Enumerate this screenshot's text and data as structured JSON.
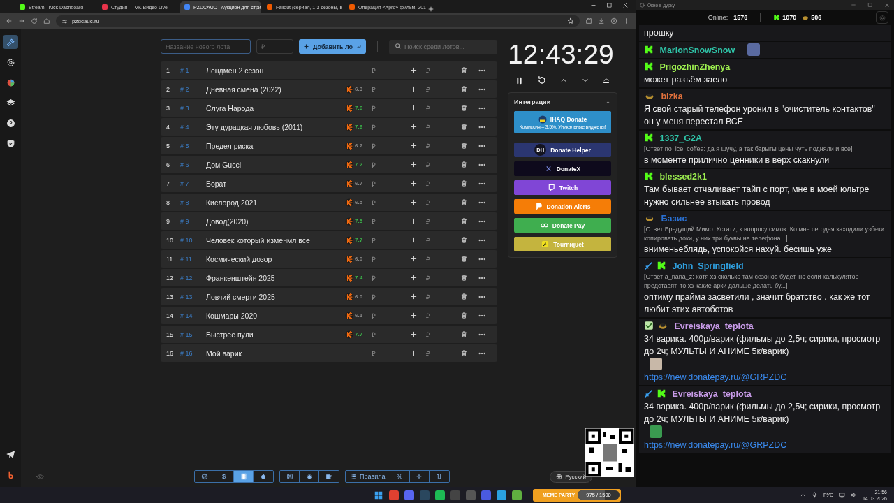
{
  "browser": {
    "tabs": [
      {
        "title": "Stream - Kick Dashboard",
        "selected": false,
        "color": "#53fc18"
      },
      {
        "title": "Студия — VK Видео Live",
        "selected": false,
        "color": "#e8334a"
      },
      {
        "title": "PZDCAUC | Аукцион для стри",
        "selected": true,
        "color": "#4285f4"
      },
      {
        "title": "Fallout (сериал, 1-3 сезоны, в",
        "selected": false,
        "color": "#f05a00"
      },
      {
        "title": "Операция «Арго» фильм, 201",
        "selected": false,
        "color": "#f05a00"
      }
    ],
    "address": "pzdcauc.ru"
  },
  "sidebar": {
    "items": [
      {
        "selected": true
      },
      {
        "selected": false
      },
      {
        "selected": false
      },
      {
        "selected": false
      },
      {
        "selected": false
      },
      {
        "selected": false
      }
    ],
    "footer_items": [
      {
        "selected": false
      },
      {
        "selected": false
      }
    ]
  },
  "lot_form": {
    "name_placeholder": "Название нового лота",
    "price_placeholder": "₽",
    "add_button": "Добавить ло",
    "search_placeholder": "Поиск среди лотов..."
  },
  "lots": [
    {
      "number": "1",
      "id": "# 1",
      "title": "Лендмен 2 сезон",
      "amount": "₽",
      "price_placeholder": "₽"
    },
    {
      "number": "2",
      "id": "# 2",
      "title": "Дневная смена (2022)",
      "rating": {
        "value": "6.3",
        "color": "#8a8a8a"
      },
      "amount": "₽",
      "price_placeholder": "₽"
    },
    {
      "number": "3",
      "id": "# 3",
      "title": "Слуга Народа",
      "rating": {
        "value": "7.6",
        "color": "#3bb54a"
      },
      "amount": "₽",
      "price_placeholder": "₽"
    },
    {
      "number": "4",
      "id": "# 4",
      "title": "Эту дурацкая любовь (2011)",
      "rating": {
        "value": "7.6",
        "color": "#3bb54a"
      },
      "amount": "₽",
      "price_placeholder": "₽"
    },
    {
      "number": "5",
      "id": "# 5",
      "title": "Предел риска",
      "rating": {
        "value": "6.7",
        "color": "#8a8a8a"
      },
      "amount": "₽",
      "price_placeholder": "₽"
    },
    {
      "number": "6",
      "id": "# 6",
      "title": "Дом Gucci",
      "rating": {
        "value": "7.2",
        "color": "#3bb54a"
      },
      "amount": "₽",
      "price_placeholder": "₽"
    },
    {
      "number": "7",
      "id": "# 7",
      "title": "Борат",
      "rating": {
        "value": "6.7",
        "color": "#8a8a8a"
      },
      "amount": "₽",
      "price_placeholder": "₽"
    },
    {
      "number": "8",
      "id": "# 8",
      "title": "Кислород 2021",
      "rating": {
        "value": "6.5",
        "color": "#8a8a8a"
      },
      "amount": "₽",
      "price_placeholder": "₽"
    },
    {
      "number": "9",
      "id": "# 9",
      "title": "Довод(2020)",
      "rating": {
        "value": "7.5",
        "color": "#3bb54a"
      },
      "amount": "₽",
      "price_placeholder": "₽"
    },
    {
      "number": "10",
      "id": "# 10",
      "title": "Человек который изменмл все",
      "rating": {
        "value": "7.7",
        "color": "#3bb54a"
      },
      "amount": "₽",
      "price_placeholder": "₽"
    },
    {
      "number": "11",
      "id": "# 11",
      "title": "Космический дозор",
      "rating": {
        "value": "6.0",
        "color": "#8a8a8a"
      },
      "amount": "₽",
      "price_placeholder": "₽"
    },
    {
      "number": "12",
      "id": "# 12",
      "title": "Франкенштейн 2025",
      "rating": {
        "value": "7.4",
        "color": "#3bb54a"
      },
      "amount": "₽",
      "price_placeholder": "₽"
    },
    {
      "number": "13",
      "id": "# 13",
      "title": "Ловчий смерти 2025",
      "rating": {
        "value": "6.0",
        "color": "#8a8a8a"
      },
      "amount": "₽",
      "price_placeholder": "₽"
    },
    {
      "number": "14",
      "id": "# 14",
      "title": "Кошмары 2020",
      "rating": {
        "value": "6.1",
        "color": "#8a8a8a"
      },
      "amount": "₽",
      "price_placeholder": "₽"
    },
    {
      "number": "15",
      "id": "# 15",
      "title": "Быстрее пули",
      "rating": {
        "value": "7.7",
        "color": "#3bb54a"
      },
      "amount": "₽",
      "price_placeholder": "₽"
    },
    {
      "number": "16",
      "id": "# 16",
      "title": "Мой варик",
      "amount": "₽",
      "price_placeholder": "₽"
    }
  ],
  "timer": "12:43:29",
  "integrations": {
    "title": "Интеграции",
    "expanded": true,
    "items": [
      {
        "name": "IHAQ Donate",
        "subtitle": "Комиссия – 3,5%. Уникальные виджеты!",
        "color": "#2e8fc9"
      },
      {
        "name": "Donate Helper",
        "badge": "DH",
        "color": "#2b3670"
      },
      {
        "name": "DonateX",
        "color": "#0e0a1c"
      },
      {
        "name": "Twitch",
        "color": "#8046d6"
      },
      {
        "name": "Donation Alerts",
        "color": "#f57d07"
      },
      {
        "name": "Donate Pay",
        "color": "#3fae4f"
      },
      {
        "name": "Tourniquet",
        "color": "#c4b43e"
      }
    ]
  },
  "toolbar": [
    [
      {
        "kind": "icon",
        "selected": false
      },
      {
        "kind": "text",
        "label": "$",
        "selected": false
      },
      {
        "kind": "icon",
        "selected": true
      },
      {
        "kind": "icon",
        "selected": false
      }
    ],
    [
      {
        "kind": "icon",
        "selected": false
      },
      {
        "kind": "icon",
        "selected": false
      },
      {
        "kind": "icon",
        "selected": false
      }
    ],
    [
      {
        "kind": "text",
        "label": "Правила",
        "selected": false
      },
      {
        "kind": "text",
        "label": "%",
        "selected": false
      },
      {
        "kind": "icon",
        "selected": false
      },
      {
        "kind": "icon",
        "selected": false
      }
    ]
  ],
  "language_button": "Русский",
  "chat": {
    "window_title": "Окно в дурку",
    "online_label": "Online:",
    "online": "1576",
    "kick_count": "1070",
    "other_count": "506",
    "messages": [
      {
        "text": "прошку"
      },
      {
        "badges": [
          {
            "kind": "kick"
          }
        ],
        "user": "MarionSnowSnow",
        "color": "#2fc4a8",
        "emote": true
      },
      {
        "badges": [
          {
            "kind": "kick"
          }
        ],
        "user": "PrigozhinZhenya",
        "color": "#9ef050",
        "text": "может разъём заело"
      },
      {
        "badges": [
          {
            "kind": "emoji"
          }
        ],
        "user": "blzka",
        "color": "#e0703c",
        "text": "Я свой старый телефон уронил в \"очиститель контактов\" он у меня перестал ВСЁ"
      },
      {
        "badges": [
          {
            "kind": "kick"
          }
        ],
        "user": "1337_G2A",
        "color": "#2fc4a8",
        "reply": "[Ответ no_ice_coffee: да я шучу, а так барыгы цены чуть подняли и все]",
        "text": "в моменте прилично ценники в верх скакнули"
      },
      {
        "badges": [
          {
            "kind": "kick"
          }
        ],
        "user": "blessed2k1",
        "color": "#9ef050",
        "text": "Там бывает отчаливает тайп с порт, мне в моей юльтре нужно сильнее втыкать провод"
      },
      {
        "badges": [
          {
            "kind": "emoji"
          }
        ],
        "user": "Базис",
        "color": "#2a6fd0",
        "reply": "[Ответ Бредущий Мимо: Кстати, к вопросу симок. Ко мне сегодня заходили узбеки копировать доки, у них три буквы на телефона...]",
        "text": "внименьеблядь, успокойся нахуй. бесишь уже"
      },
      {
        "badges": [
          {
            "kind": "sword"
          },
          {
            "kind": "kick"
          }
        ],
        "user": "John_Springfield",
        "color": "#2fa0e0",
        "reply": "[Ответ a_nana_z: хотя хз сколько там сезонов будет, но если калькулятор представят, то хз какие арки дальше делать бу...]",
        "text": "оптиму прайма засветили , значит братство . как же тот любит этих автоботов"
      },
      {
        "badges": [
          {
            "kind": "check"
          },
          {
            "kind": "emoji"
          }
        ],
        "user": "Evreiskaya_teplota",
        "color": "#c89be8",
        "text": "34 варика. 400р/варик (фильмы до 2,5ч; сирики, просмотр до 2ч; МУЛЬТЫ И АНИМЕ 5к/варик)",
        "emote": true,
        "link": "https://new.donatepay.ru/@GRPZDC"
      },
      {
        "badges": [
          {
            "kind": "sword"
          },
          {
            "kind": "kick"
          }
        ],
        "user": "Evreiskaya_teplota",
        "color": "#c89be8",
        "text": "34 варика. 400р/варик (фильмы до 2,5ч; сирики, просмотр до 2ч; МУЛЬТЫ И АНИМЕ 5к/варик)",
        "emote": true,
        "link": "https://new.donatepay.ru/@GRPZDC"
      }
    ]
  },
  "taskbar": {
    "widget_title": "MEME PARTY",
    "widget_progress": "975 / 1500",
    "level": 0.65,
    "language": "РУС",
    "time": "21:56",
    "date": "14.03.2026"
  }
}
